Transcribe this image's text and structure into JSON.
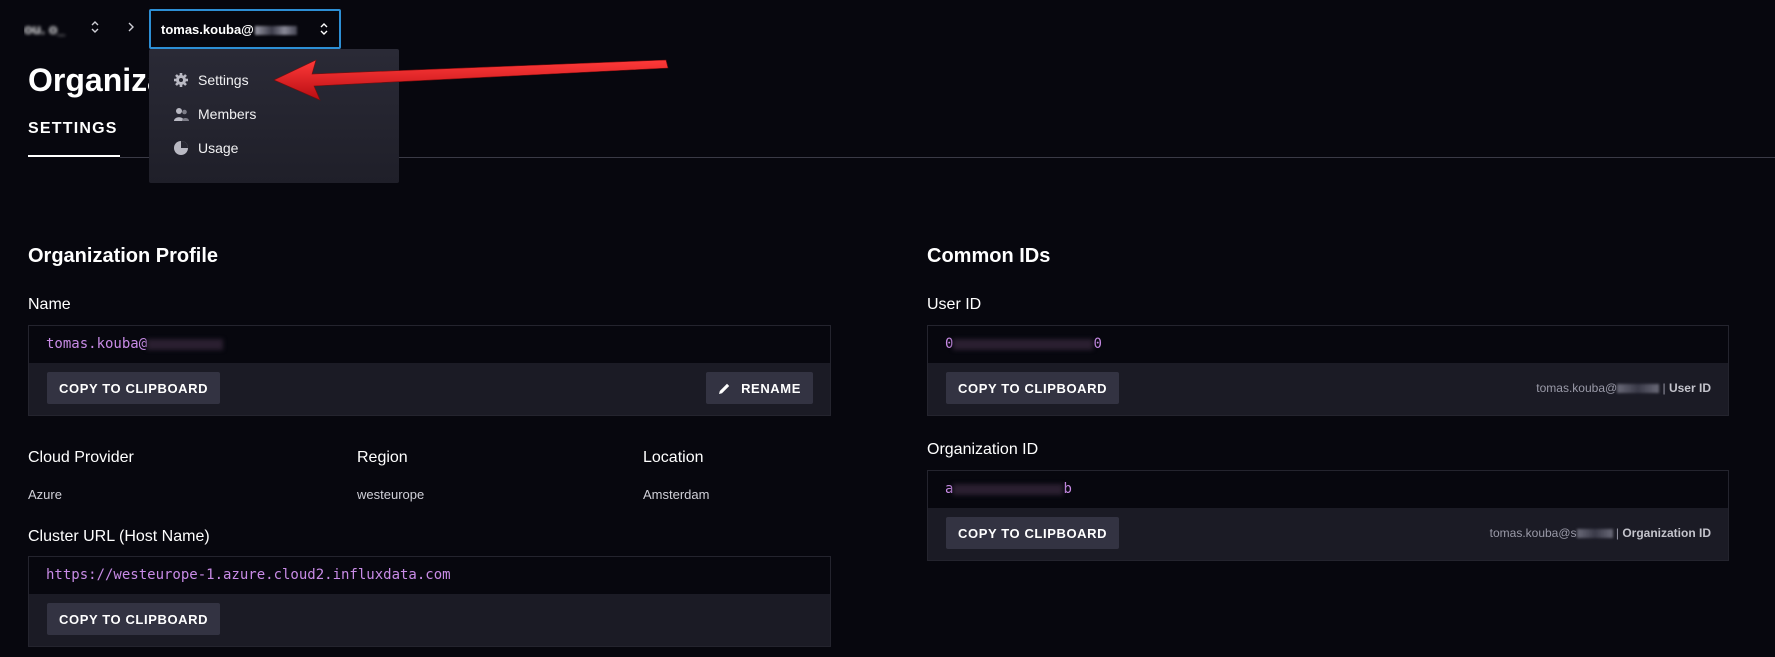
{
  "header": {
    "org_name_partial": "ou. o_",
    "account_select": {
      "text": "tomas.kouba@",
      "redacted_suffix": "s…"
    }
  },
  "dropdown": {
    "items": [
      {
        "label": "Settings",
        "icon": "gear-icon"
      },
      {
        "label": "Members",
        "icon": "members-icon"
      },
      {
        "label": "Usage",
        "icon": "pie-chart-icon"
      }
    ]
  },
  "page": {
    "title": "Organization",
    "tab_settings": "SETTINGS"
  },
  "profile": {
    "title": "Organization Profile",
    "name_label": "Name",
    "name_value": "tomas.kouba@",
    "copy_label": "COPY TO CLIPBOARD",
    "rename_label": "RENAME",
    "cloud_provider_label": "Cloud Provider",
    "cloud_provider_value": "Azure",
    "region_label": "Region",
    "region_value": "westeurope",
    "location_label": "Location",
    "location_value": "Amsterdam",
    "cluster_url_label": "Cluster URL (Host Name)",
    "cluster_url_value": "https://westeurope-1.azure.cloud2.influxdata.com"
  },
  "common_ids": {
    "title": "Common IDs",
    "user_id_label": "User ID",
    "user_id_prefix": "0",
    "user_id_suffix": "0",
    "user_hint_prefix": "tomas.kouba@",
    "user_hint_suffix": "User ID",
    "org_id_label": "Organization ID",
    "org_id_prefix": "a",
    "org_id_suffix": "b",
    "org_hint_prefix": "tomas.kouba@s",
    "org_hint_suffix": "Organization ID",
    "copy_label": "COPY TO CLIPBOARD"
  },
  "colors": {
    "background": "#07070e",
    "value_text": "#c88be6",
    "focus_border": "#2d8fd5",
    "annotation_arrow": "#e0151b"
  }
}
